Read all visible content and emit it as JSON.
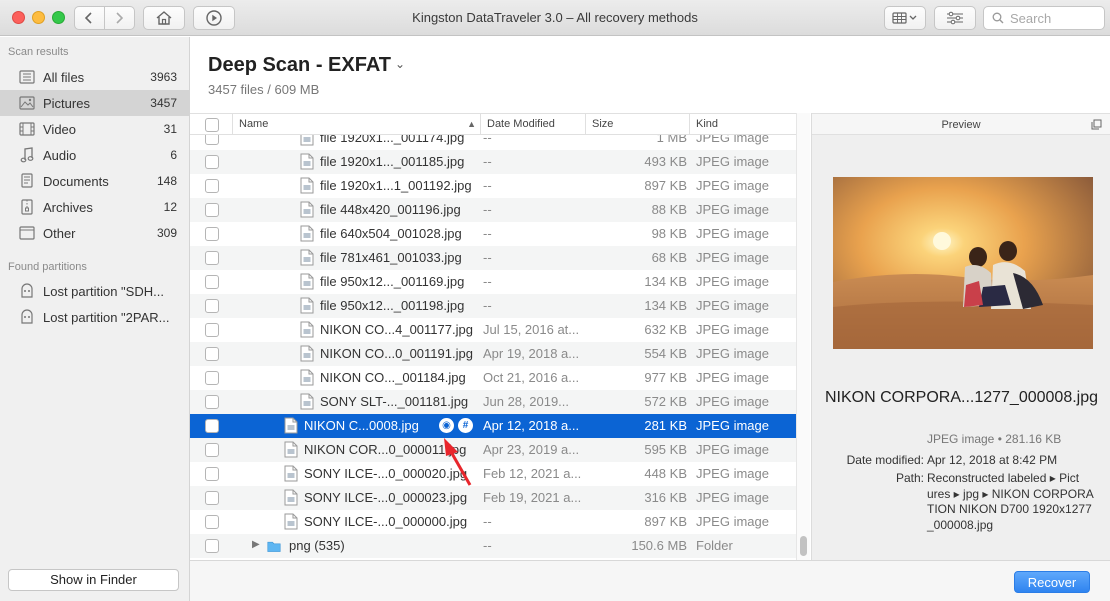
{
  "window": {
    "title": "Kingston DataTraveler 3.0 – All recovery methods",
    "search_placeholder": "Search"
  },
  "sidebar": {
    "scan_results_heading": "Scan results",
    "items": [
      {
        "label": "All files",
        "count": "3963",
        "icon": "all-files-icon"
      },
      {
        "label": "Pictures",
        "count": "3457",
        "icon": "pictures-icon"
      },
      {
        "label": "Video",
        "count": "31",
        "icon": "video-icon"
      },
      {
        "label": "Audio",
        "count": "6",
        "icon": "audio-icon"
      },
      {
        "label": "Documents",
        "count": "148",
        "icon": "documents-icon"
      },
      {
        "label": "Archives",
        "count": "12",
        "icon": "archives-icon"
      },
      {
        "label": "Other",
        "count": "309",
        "icon": "other-icon"
      }
    ],
    "found_partitions_heading": "Found partitions",
    "partitions": [
      {
        "label": "Lost partition \"SDH..."
      },
      {
        "label": "Lost partition \"2PAR..."
      }
    ],
    "show_in_finder": "Show in Finder"
  },
  "header": {
    "title": "Deep Scan - EXFAT",
    "subtitle": "3457 files / 609 MB"
  },
  "columns": {
    "name": "Name",
    "date": "Date Modified",
    "size": "Size",
    "kind": "Kind"
  },
  "rows": [
    {
      "name": "file 1920x1..._001174.jpg",
      "date": "--",
      "size": "1 MB",
      "kind": "JPEG image"
    },
    {
      "name": "file 1920x1..._001185.jpg",
      "date": "--",
      "size": "493 KB",
      "kind": "JPEG image"
    },
    {
      "name": "file 1920x1...1_001192.jpg",
      "date": "--",
      "size": "897 KB",
      "kind": "JPEG image"
    },
    {
      "name": "file 448x420_001196.jpg",
      "date": "--",
      "size": "88 KB",
      "kind": "JPEG image"
    },
    {
      "name": "file 640x504_001028.jpg",
      "date": "--",
      "size": "98 KB",
      "kind": "JPEG image"
    },
    {
      "name": "file 781x461_001033.jpg",
      "date": "--",
      "size": "68 KB",
      "kind": "JPEG image"
    },
    {
      "name": "file 950x12..._001169.jpg",
      "date": "--",
      "size": "134 KB",
      "kind": "JPEG image"
    },
    {
      "name": "file 950x12..._001198.jpg",
      "date": "--",
      "size": "134 KB",
      "kind": "JPEG image"
    },
    {
      "name": "NIKON CO...4_001177.jpg",
      "date": "Jul 15, 2016 at...",
      "size": "632 KB",
      "kind": "JPEG image"
    },
    {
      "name": "NIKON CO...0_001191.jpg",
      "date": "Apr 19, 2018 a...",
      "size": "554 KB",
      "kind": "JPEG image"
    },
    {
      "name": "NIKON CO..._001184.jpg",
      "date": "Oct 21, 2016 a...",
      "size": "977 KB",
      "kind": "JPEG image"
    },
    {
      "name": "SONY SLT-..._001181.jpg",
      "date": "Jun 28, 2019...",
      "size": "572 KB",
      "kind": "JPEG image"
    },
    {
      "name": "NIKON C...0008.jpg",
      "date": "Apr 12, 2018 a...",
      "size": "281 KB",
      "kind": "JPEG image"
    },
    {
      "name": "NIKON COR...0_000011.jpg",
      "date": "Apr 23, 2019 a...",
      "size": "595 KB",
      "kind": "JPEG image"
    },
    {
      "name": "SONY ILCE-...0_000020.jpg",
      "date": "Feb 12, 2021 a...",
      "size": "448 KB",
      "kind": "JPEG image"
    },
    {
      "name": "SONY ILCE-...0_000023.jpg",
      "date": "Feb 19, 2021 a...",
      "size": "316 KB",
      "kind": "JPEG image"
    },
    {
      "name": "SONY ILCE-...0_000000.jpg",
      "date": "--",
      "size": "897 KB",
      "kind": "JPEG image"
    },
    {
      "name": "png (535)",
      "date": "--",
      "size": "150.6 MB",
      "kind": "Folder"
    }
  ],
  "preview": {
    "heading": "Preview",
    "file_name": "NIKON CORPORA...1277_000008.jpg",
    "type_size": "JPEG image • 281.16 KB",
    "date_label": "Date modified:",
    "date_value": "Apr 12, 2018 at 8:42 PM",
    "path_label": "Path:",
    "path_lines": [
      "Reconstructed labeled ▸ Pict",
      "ures ▸ jpg ▸ NIKON CORPORA",
      "TION NIKON D700 1920x1277",
      "_000008.jpg"
    ]
  },
  "recover_button": "Recover",
  "colors": {
    "selection": "#0b64d4",
    "accent": "#2f84f0",
    "arrow": "#e8262c"
  }
}
